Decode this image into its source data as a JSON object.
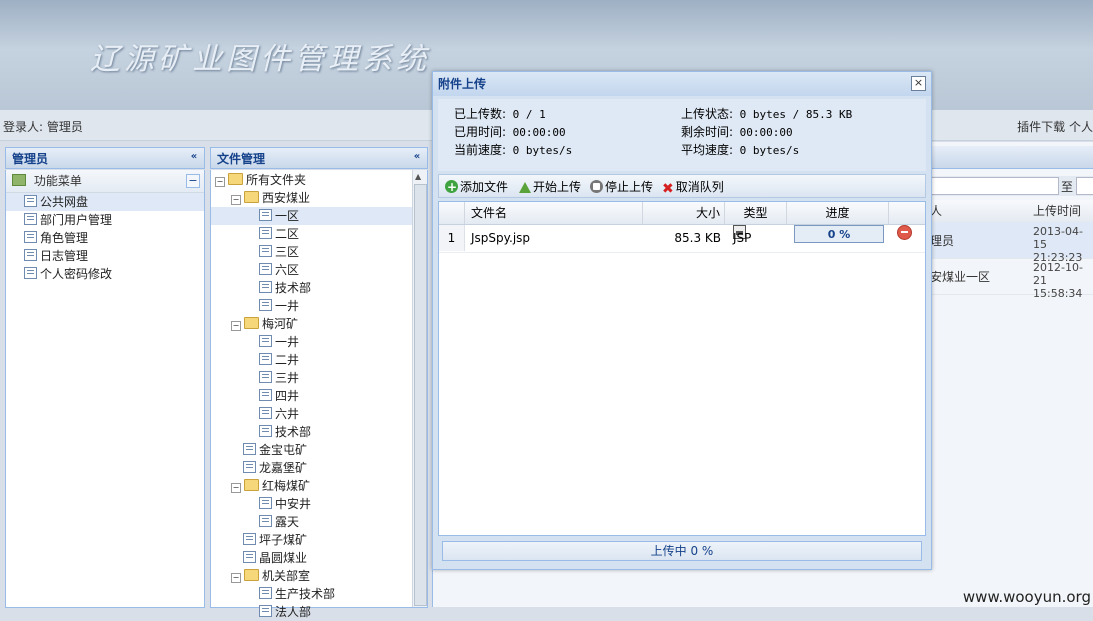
{
  "header": {
    "title": "辽源矿业图件管理系统"
  },
  "loginbar": {
    "login_label": "登录人:",
    "user": "管理员",
    "plugin_download": "插件下载",
    "right_extra": "个人"
  },
  "left_panel": {
    "title": "管理员",
    "collapse_icon": "«",
    "menu_title": "功能菜单",
    "items": [
      "公共网盘",
      "部门用户管理",
      "角色管理",
      "日志管理",
      "个人密码修改"
    ],
    "selected_index": 0
  },
  "mid_panel": {
    "title": "文件管理",
    "collapse_icon": "«",
    "tree": [
      {
        "label": "所有文件夹",
        "type": "folder",
        "level": 0
      },
      {
        "label": "西安煤业",
        "type": "folder",
        "level": 1
      },
      {
        "label": "一区",
        "type": "leaf",
        "level": 2
      },
      {
        "label": "二区",
        "type": "leaf",
        "level": 2
      },
      {
        "label": "三区",
        "type": "leaf",
        "level": 2
      },
      {
        "label": "六区",
        "type": "leaf",
        "level": 2
      },
      {
        "label": "技术部",
        "type": "leaf",
        "level": 2
      },
      {
        "label": "一井",
        "type": "leaf",
        "level": 2
      },
      {
        "label": "梅河矿",
        "type": "folder",
        "level": 1
      },
      {
        "label": "一井",
        "type": "leaf",
        "level": 2
      },
      {
        "label": "二井",
        "type": "leaf",
        "level": 2
      },
      {
        "label": "三井",
        "type": "leaf",
        "level": 2
      },
      {
        "label": "四井",
        "type": "leaf",
        "level": 2
      },
      {
        "label": "六井",
        "type": "leaf",
        "level": 2
      },
      {
        "label": "技术部",
        "type": "leaf",
        "level": 2
      },
      {
        "label": "金宝屯矿",
        "type": "leaf",
        "level": 1
      },
      {
        "label": "龙嘉堡矿",
        "type": "leaf",
        "level": 1
      },
      {
        "label": "红梅煤矿",
        "type": "folder",
        "level": 1
      },
      {
        "label": "中安井",
        "type": "leaf",
        "level": 2
      },
      {
        "label": "露天",
        "type": "leaf",
        "level": 2
      },
      {
        "label": "坪子煤矿",
        "type": "leaf",
        "level": 1
      },
      {
        "label": "晶圆煤业",
        "type": "leaf",
        "level": 1
      },
      {
        "label": "机关部室",
        "type": "folder",
        "level": 1
      },
      {
        "label": "生产技术部",
        "type": "leaf",
        "level": 2
      },
      {
        "label": "法人部",
        "type": "leaf",
        "level": 2
      }
    ],
    "selected_index": 2
  },
  "right_panel": {
    "filter_to": "至",
    "columns": [
      "人",
      "上传时间"
    ],
    "rows": [
      {
        "c1": "理员",
        "date": "2013-04-15",
        "time": "21:23:23"
      },
      {
        "c1": "安煤业一区",
        "date": "2012-10-21",
        "time": "15:58:34"
      }
    ]
  },
  "dialog": {
    "title": "附件上传",
    "close_icon": "×",
    "stats": {
      "uploaded_label": "已上传数:",
      "uploaded_value": "0 / 1",
      "status_label": "上传状态:",
      "status_value": "0 bytes / 85.3 KB",
      "elapsed_label": "已用时间:",
      "elapsed_value": "00:00:00",
      "remaining_label": "剩余时间:",
      "remaining_value": "00:00:00",
      "speed_label": "当前速度:",
      "speed_value": "0 bytes/s",
      "avg_label": "平均速度:",
      "avg_value": "0 bytes/s"
    },
    "toolbar": {
      "add": "添加文件",
      "start": "开始上传",
      "stop": "停止上传",
      "cancel": "取消队列"
    },
    "columns": {
      "name": "文件名",
      "size": "大小",
      "type": "类型",
      "progress": "进度"
    },
    "files": [
      {
        "num": "1",
        "name": "JspSpy.jsp",
        "size": "85.3 KB",
        "type": "JSP",
        "progress": "0 %"
      }
    ],
    "status": "上传中 0 %"
  },
  "watermark": "www.wooyun.org"
}
